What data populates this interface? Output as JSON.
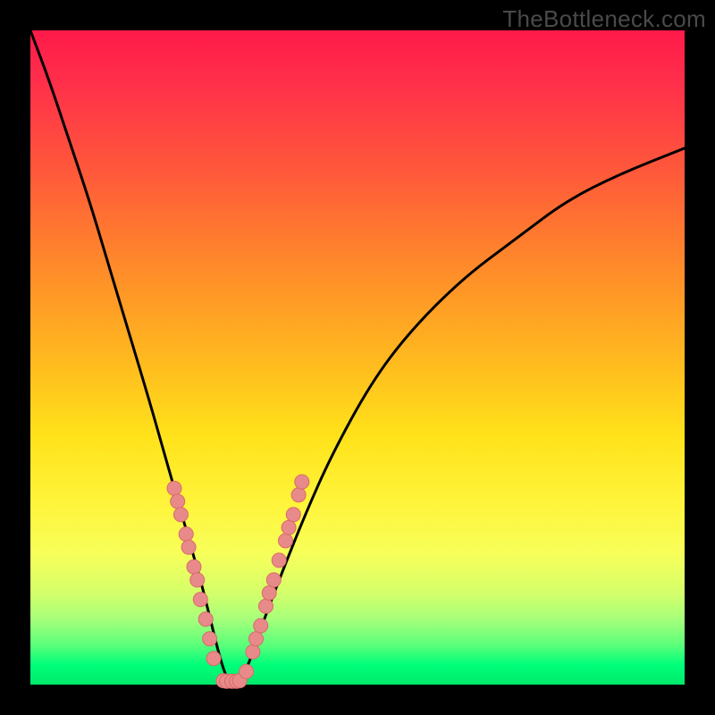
{
  "watermark": "TheBottleneck.com",
  "chart_data": {
    "type": "line",
    "title": "",
    "xlabel": "",
    "ylabel": "",
    "xlim": [
      0,
      100
    ],
    "ylim": [
      0,
      100
    ],
    "series": [
      {
        "name": "curve",
        "x": [
          0,
          3,
          6,
          9,
          12,
          15,
          18,
          20,
          22,
          24,
          26,
          27,
          28,
          29,
          30,
          31,
          33,
          35,
          38,
          42,
          46,
          52,
          58,
          66,
          74,
          82,
          90,
          100
        ],
        "y": [
          100,
          92,
          83,
          74,
          64,
          54,
          44,
          37,
          30,
          23,
          16,
          12,
          8,
          4,
          1,
          0,
          2,
          8,
          16,
          26,
          35,
          46,
          54,
          62,
          68,
          74,
          78,
          82
        ]
      }
    ],
    "markers": [
      {
        "x": 22,
        "y": 30
      },
      {
        "x": 22.5,
        "y": 28
      },
      {
        "x": 23,
        "y": 26
      },
      {
        "x": 23.8,
        "y": 23
      },
      {
        "x": 24.2,
        "y": 21
      },
      {
        "x": 25,
        "y": 18
      },
      {
        "x": 25.5,
        "y": 16
      },
      {
        "x": 26,
        "y": 13
      },
      {
        "x": 26.8,
        "y": 10
      },
      {
        "x": 27.4,
        "y": 7
      },
      {
        "x": 28,
        "y": 4
      },
      {
        "x": 29.5,
        "y": 0.6
      },
      {
        "x": 30,
        "y": 0.5
      },
      {
        "x": 30.8,
        "y": 0.5
      },
      {
        "x": 31.5,
        "y": 0.5
      },
      {
        "x": 32,
        "y": 0.6
      },
      {
        "x": 33,
        "y": 2
      },
      {
        "x": 34,
        "y": 5
      },
      {
        "x": 34.5,
        "y": 7
      },
      {
        "x": 35.2,
        "y": 9
      },
      {
        "x": 36,
        "y": 12
      },
      {
        "x": 36.5,
        "y": 14
      },
      {
        "x": 37.2,
        "y": 16
      },
      {
        "x": 38,
        "y": 19
      },
      {
        "x": 39,
        "y": 22
      },
      {
        "x": 39.5,
        "y": 24
      },
      {
        "x": 40.2,
        "y": 26
      },
      {
        "x": 41,
        "y": 29
      },
      {
        "x": 41.5,
        "y": 31
      }
    ],
    "colors": {
      "curve": "#000000",
      "markers_fill": "#e88a8a",
      "markers_stroke": "#d86a6a",
      "background_top": "#ff1a4a",
      "background_mid": "#ffe21a",
      "background_bottom": "#00e96a",
      "frame": "#000000"
    }
  }
}
